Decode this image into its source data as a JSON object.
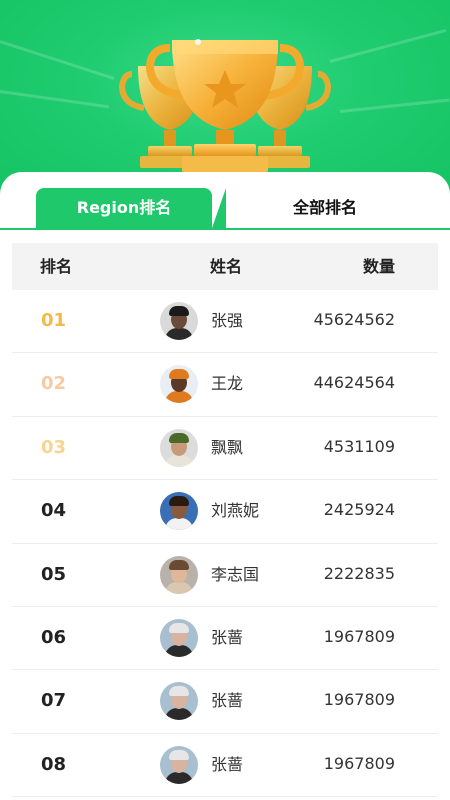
{
  "colors": {
    "brand_green": "#1fc96b",
    "rank_gold": "#f5b94a",
    "rank_silver": "#f8caa2",
    "rank_bronze": "#f7d58f",
    "rank_default": "#222222"
  },
  "hero": {
    "icon": "trophy-icon"
  },
  "tabs": [
    {
      "label": "Region排名",
      "active": true
    },
    {
      "label": "全部排名",
      "active": false
    }
  ],
  "table": {
    "headers": {
      "rank": "排名",
      "name": "姓名",
      "count": "数量"
    },
    "rows": [
      {
        "rank": "01",
        "name": "张强",
        "count": "45624562",
        "avatar": {
          "bg": "#d9d9d9",
          "skin": "#6b4a3a",
          "cloth": "#2a2a2a",
          "hair": "#1a1a1a"
        }
      },
      {
        "rank": "02",
        "name": "王龙",
        "count": "44624564",
        "avatar": {
          "bg": "#e8eef3",
          "skin": "#5a3a26",
          "cloth": "#e07a1e",
          "hair": "#e07a1e"
        }
      },
      {
        "rank": "03",
        "name": "飘飘",
        "count": "4531109",
        "avatar": {
          "bg": "#dcdcdc",
          "skin": "#c99a7a",
          "cloth": "#e9e4d8",
          "hair": "#4a6a2a"
        }
      },
      {
        "rank": "04",
        "name": "刘燕妮",
        "count": "2425924",
        "avatar": {
          "bg": "#3b6fb5",
          "skin": "#8a5a3e",
          "cloth": "#f2f2f2",
          "hair": "#2a1a12"
        }
      },
      {
        "rank": "05",
        "name": "李志国",
        "count": "2222835",
        "avatar": {
          "bg": "#b8b2aa",
          "skin": "#e0b79a",
          "cloth": "#d9c7b0",
          "hair": "#6a4a32"
        }
      },
      {
        "rank": "06",
        "name": "张蔷",
        "count": "1967809",
        "avatar": {
          "bg": "#a8bfcf",
          "skin": "#d7b3a0",
          "cloth": "#2a2a2a",
          "hair": "#e6e6e6"
        }
      },
      {
        "rank": "07",
        "name": "张蔷",
        "count": "1967809",
        "avatar": {
          "bg": "#a8bfcf",
          "skin": "#d7b3a0",
          "cloth": "#2a2a2a",
          "hair": "#e6e6e6"
        }
      },
      {
        "rank": "08",
        "name": "张蔷",
        "count": "1967809",
        "avatar": {
          "bg": "#a8bfcf",
          "skin": "#d7b3a0",
          "cloth": "#2a2a2a",
          "hair": "#e6e6e6"
        }
      }
    ]
  }
}
